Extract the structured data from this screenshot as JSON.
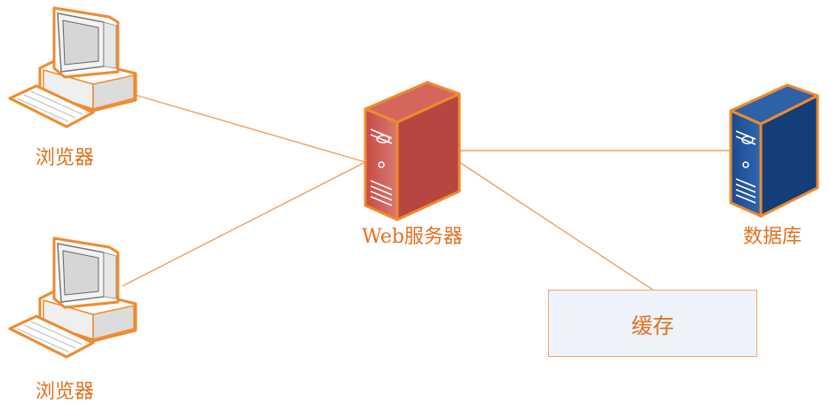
{
  "nodes": {
    "browser1": {
      "label": "浏览器",
      "icon": "desktop-computer-icon"
    },
    "browser2": {
      "label": "浏览器",
      "icon": "desktop-computer-icon"
    },
    "web_server": {
      "label": "Web服务器",
      "icon": "server-tower-icon",
      "color": "#c9514a"
    },
    "database": {
      "label": "数据库",
      "icon": "server-tower-icon",
      "color": "#1f4f93"
    },
    "cache": {
      "label": "缓存"
    }
  },
  "colors": {
    "accent": "#e0721f",
    "connector": "#f0a060",
    "cache_fill": "#eef2fb"
  }
}
